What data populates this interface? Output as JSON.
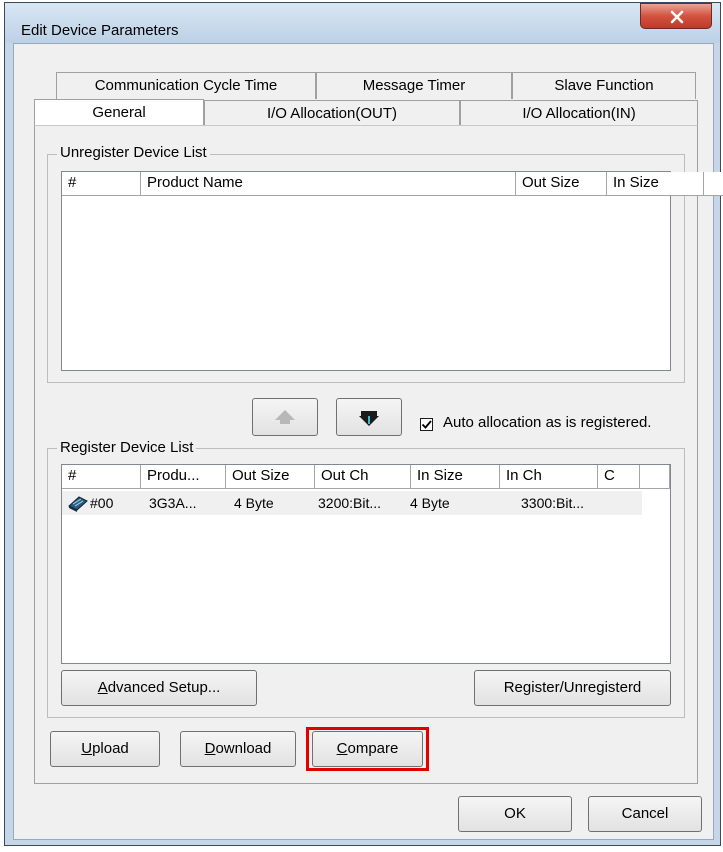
{
  "window": {
    "title": "Edit Device Parameters",
    "close_symbol": "x"
  },
  "tabs": {
    "row1": [
      "Communication Cycle Time",
      "Message Timer",
      "Slave Function"
    ],
    "row2": [
      "General",
      "I/O Allocation(OUT)",
      "I/O Allocation(IN)"
    ],
    "active": "General"
  },
  "unregister": {
    "label": "Unregister Device List",
    "columns": [
      "#",
      "Product Name",
      "Out Size",
      "In Size",
      ""
    ]
  },
  "arrows": {
    "up_icon": "arrow-up-icon",
    "down_icon": "arrow-down-icon"
  },
  "auto_allocation": {
    "label": "Auto allocation as is registered.",
    "checked": true
  },
  "register": {
    "label": "Register Device List",
    "columns": [
      "#",
      "Produ...",
      "Out Size",
      "Out Ch",
      "In Size",
      "In Ch",
      "C",
      ""
    ],
    "rows": [
      {
        "icon": "device-icon",
        "num": "#00",
        "product": "3G3A...",
        "out_size": "4 Byte",
        "out_ch": "3200:Bit...",
        "in_size": "4 Byte",
        "in_ch": "3300:Bit..."
      }
    ]
  },
  "buttons": {
    "advanced_setup": {
      "u": "A",
      "rest": "dvanced Setup..."
    },
    "register_unregister": "Register/Unregisterd",
    "upload": {
      "u": "U",
      "rest": "pload"
    },
    "download": {
      "u": "D",
      "rest": "ownload"
    },
    "compare": {
      "u": "C",
      "rest": "ompare"
    },
    "ok": "OK",
    "cancel": "Cancel"
  },
  "colors": {
    "highlight": "#e00000",
    "close_button": "#c0392b",
    "window_frame": "#c4d6e8"
  }
}
